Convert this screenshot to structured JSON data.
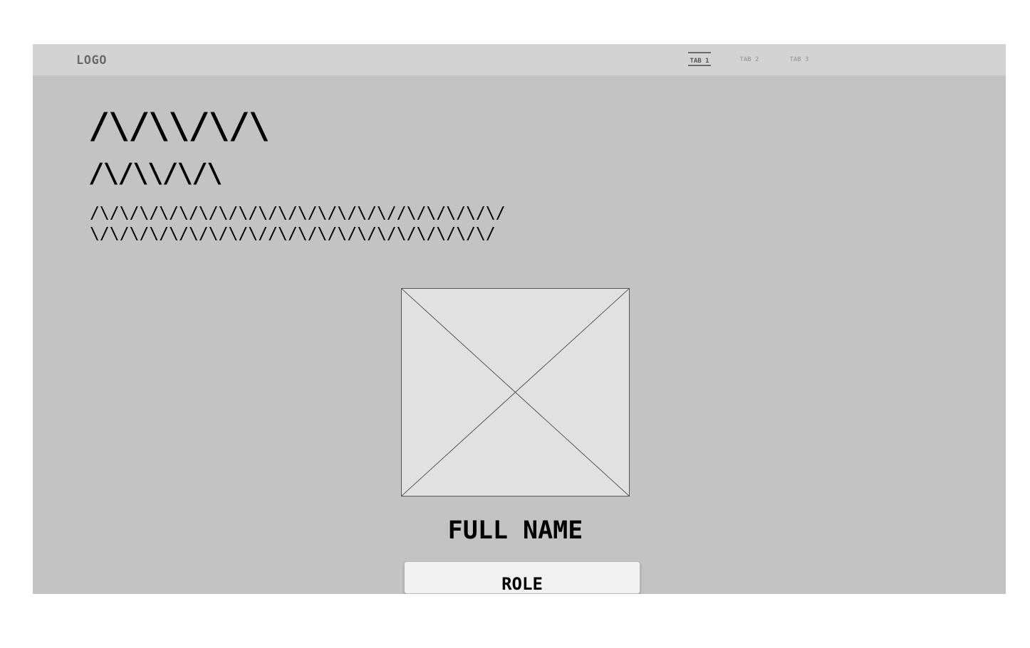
{
  "header": {
    "logo": "LOGO",
    "tabs": [
      {
        "label": "TAB 1",
        "active": true
      },
      {
        "label": "TAB 2",
        "active": false
      },
      {
        "label": "TAB 3",
        "active": false
      }
    ]
  },
  "hero": {
    "heading": "/\\/\\\\/\\/\\",
    "subheading": "/\\/\\\\/\\/\\",
    "body_lines": [
      "/\\/\\/\\/\\/\\/\\/\\/\\/\\/\\/\\/\\/\\/\\/\\//\\/\\/\\/\\/\\/",
      "\\/\\/\\/\\/\\/\\/\\/\\/\\//\\/\\/\\/\\/\\/\\/\\/\\/\\/\\/\\/"
    ]
  },
  "profile": {
    "full_name": "FULL NAME",
    "role": "ROLE"
  },
  "colors": {
    "page_background": "#ffffff",
    "frame_background": "#c3c3c3",
    "topbar_background": "#d3d3d3",
    "image_fill": "#e1e1e1",
    "role_fill": "#f2f2f2",
    "text": "#000000"
  },
  "icons": {
    "image_placeholder": "image-placeholder-cross"
  }
}
